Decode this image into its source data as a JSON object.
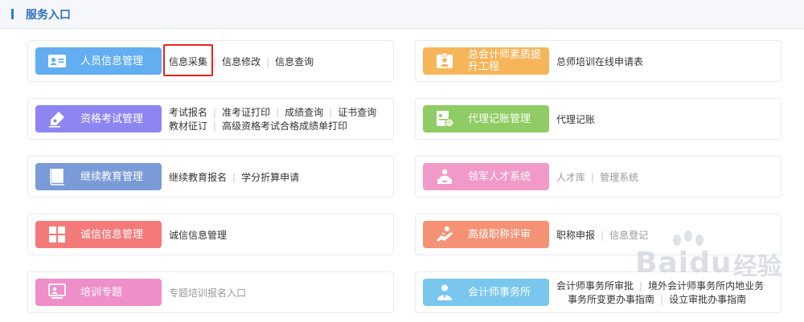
{
  "header": {
    "title": "服务入口"
  },
  "colors": {
    "blue": "#63aef0",
    "purple": "#8d85f2",
    "indigo": "#7a9ad8",
    "red": "#f47a7a",
    "pink": "#ee8fc9",
    "orange": "#f6b559",
    "green": "#8fcc63",
    "rose": "#f19ac7",
    "salmon": "#f59275",
    "sky": "#79c6ee"
  },
  "left": [
    {
      "label": "人员信息管理",
      "icon": "id-card-icon",
      "links": [
        [
          "信息采集",
          "信息修改",
          "信息查询"
        ]
      ]
    },
    {
      "label": "资格考试管理",
      "icon": "pen-icon",
      "links": [
        [
          "考试报名",
          "准考证打印",
          "成绩查询",
          "证书查询"
        ],
        [
          "教材征订",
          "高级资格考试合格成绩单打印"
        ]
      ]
    },
    {
      "label": "继续教育管理",
      "icon": "book-icon",
      "links": [
        [
          "继续教育报名",
          "学分折算申请"
        ]
      ]
    },
    {
      "label": "诚信信息管理",
      "icon": "grid-icon",
      "links": [
        [
          "诚信信息管理"
        ]
      ]
    },
    {
      "label": "培训专题",
      "icon": "presentation-icon",
      "links": [
        [
          "专题培训报名入口"
        ]
      ]
    }
  ],
  "right": [
    {
      "label": "总会计师素质提升工程",
      "icon": "badge-icon",
      "links": [
        [
          "总师培训在线申请表"
        ]
      ]
    },
    {
      "label": "代理记账管理",
      "icon": "agent-icon",
      "links": [
        [
          "代理记账"
        ]
      ]
    },
    {
      "label": "领军人才系统",
      "icon": "leader-icon",
      "links": [
        [
          "人才库",
          "管理系统"
        ]
      ]
    },
    {
      "label": "高级职称评审",
      "icon": "handshake-icon",
      "links": [
        [
          "职称申报",
          "信息登记"
        ]
      ]
    },
    {
      "label": "会计师事务所",
      "icon": "person-icon",
      "links": [
        [
          "会计师事务所审批",
          "境外会计师事务所内地业务"
        ],
        [
          "事务所变更办事指南",
          "设立审批办事指南"
        ]
      ]
    }
  ],
  "watermark": {
    "text": "Baidu",
    "sub": "经验"
  }
}
